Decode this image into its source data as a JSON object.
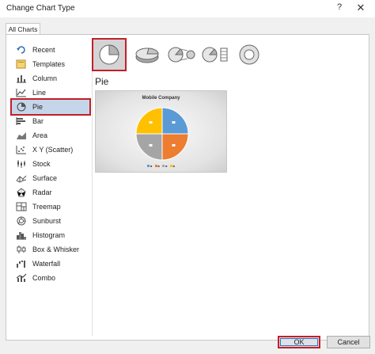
{
  "window": {
    "title": "Change Chart Type",
    "help_glyph": "?",
    "close_glyph": "✕"
  },
  "tabs": [
    {
      "label": "All Charts"
    }
  ],
  "sidebar": {
    "items": [
      {
        "label": "Recent",
        "icon": "recent-icon"
      },
      {
        "label": "Templates",
        "icon": "templates-icon"
      },
      {
        "label": "Column",
        "icon": "column-chart-icon"
      },
      {
        "label": "Line",
        "icon": "line-chart-icon"
      },
      {
        "label": "Pie",
        "icon": "pie-chart-icon",
        "selected": true
      },
      {
        "label": "Bar",
        "icon": "bar-chart-icon"
      },
      {
        "label": "Area",
        "icon": "area-chart-icon"
      },
      {
        "label": "X Y (Scatter)",
        "icon": "scatter-chart-icon"
      },
      {
        "label": "Stock",
        "icon": "stock-chart-icon"
      },
      {
        "label": "Surface",
        "icon": "surface-chart-icon"
      },
      {
        "label": "Radar",
        "icon": "radar-chart-icon"
      },
      {
        "label": "Treemap",
        "icon": "treemap-chart-icon"
      },
      {
        "label": "Sunburst",
        "icon": "sunburst-chart-icon"
      },
      {
        "label": "Histogram",
        "icon": "histogram-chart-icon"
      },
      {
        "label": "Box & Whisker",
        "icon": "box-whisker-chart-icon"
      },
      {
        "label": "Waterfall",
        "icon": "waterfall-chart-icon"
      },
      {
        "label": "Combo",
        "icon": "combo-chart-icon"
      }
    ]
  },
  "subtypes": [
    {
      "icon": "pie-subtype-icon",
      "selected": true
    },
    {
      "icon": "3d-pie-subtype-icon"
    },
    {
      "icon": "pie-of-pie-subtype-icon"
    },
    {
      "icon": "bar-of-pie-subtype-icon"
    },
    {
      "icon": "doughnut-subtype-icon"
    }
  ],
  "preview": {
    "heading": "Pie",
    "chart_title": "Mobile Company",
    "colors": [
      "#5b9bd5",
      "#ed7d31",
      "#a5a5a5",
      "#ffc000"
    ],
    "slice_fractions": [
      0.25,
      0.25,
      0.25,
      0.25
    ]
  },
  "buttons": {
    "ok": "OK",
    "cancel": "Cancel"
  },
  "colors": {
    "selection_outline": "#c0202a",
    "selected_bg": "#c6d6ea",
    "dialog_bg": "#f0f0f0"
  }
}
